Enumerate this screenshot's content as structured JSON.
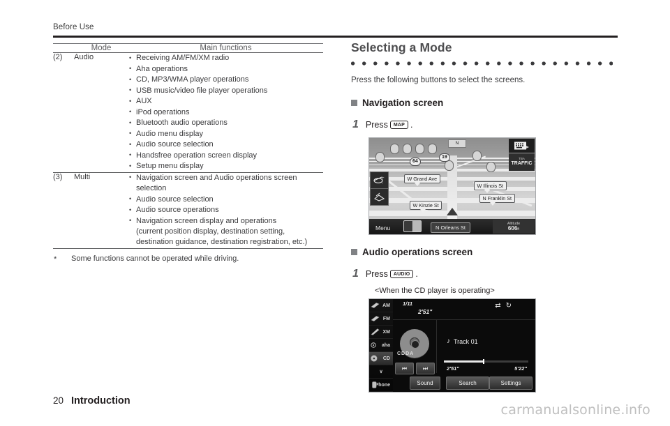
{
  "running_head": "Before Use",
  "page_footer": {
    "number": "20",
    "section": "Introduction"
  },
  "watermark": "carmanualsonline.info",
  "table": {
    "headers": {
      "num": "",
      "mode": "Mode",
      "functions": "Main functions"
    },
    "rows": [
      {
        "num": "(2)",
        "mode": "Audio",
        "functions": [
          "Receiving AM/FM/XM radio",
          "Aha operations",
          "CD, MP3/WMA player operations",
          "USB music/video file player operations",
          "AUX",
          "iPod operations",
          "Bluetooth audio operations",
          "Audio menu display",
          "Audio source selection",
          "Handsfree operation screen display",
          "Setup menu display"
        ]
      },
      {
        "num": "(3)",
        "mode": "Multi",
        "functions": [
          "Navigation screen and Audio operations screen",
          "Audio source selection",
          "Audio source operations",
          "Navigation screen display and operations"
        ],
        "continuations": {
          "0": "selection",
          "3": "(current position display, destination setting, destination guidance, destination registration, etc.)"
        }
      }
    ],
    "footnote": {
      "marker": "*",
      "text": "Some functions cannot be operated while driving."
    }
  },
  "right": {
    "section_title": "Selecting a Mode",
    "lead": "Press the following buttons to select the screens.",
    "nav_block": {
      "heading": "Navigation screen",
      "step_number": "1",
      "step_text_before": "Press",
      "key_label": "MAP",
      "step_text_after": "."
    },
    "audio_block": {
      "heading": "Audio operations screen",
      "step_number": "1",
      "step_text_before": "Press",
      "key_label": "AUDIO",
      "step_text_after": ".",
      "caption": "<When the CD player is operating>"
    }
  },
  "nav_screen": {
    "compass": "N",
    "shields": [
      {
        "label": "64"
      },
      {
        "label": "19"
      }
    ],
    "street_bubbles": [
      "W Grand Ave",
      "W Illinois St",
      "N Franklin St",
      "W Kinzie St"
    ],
    "keyboard_icon": "keyboard-icon",
    "traffic_button": {
      "small": "TBA",
      "label": "TRAFFIC"
    },
    "zoom_control": "zoom-in-out-icon",
    "view_control": "map-view-icon",
    "menu_label": "Menu",
    "split_screen_icon": "split-screen-icon",
    "current_street": "N Orleans St",
    "altitude": {
      "label": "Altitude",
      "value": "606",
      "unit": "ft"
    }
  },
  "audio_screen": {
    "sources": [
      {
        "label": "AM",
        "selected": false
      },
      {
        "label": "FM",
        "selected": false
      },
      {
        "label": "XM",
        "selected": false
      },
      {
        "label": "aha",
        "selected": false
      },
      {
        "label": "CD",
        "selected": true
      },
      {
        "label": "∨",
        "selected": false
      },
      {
        "label": "Phone",
        "selected": false
      }
    ],
    "track_number": "1/11",
    "track_time": "2'51\"",
    "shuffle_icon": "shuffle-icon",
    "repeat_icon": "repeat-icon",
    "disc_label": "CDDA",
    "prev_button": "⏮",
    "next_button": "⏭",
    "track_title": "Track 01",
    "elapsed": "2'51\"",
    "total": "5'22\"",
    "buttons": {
      "sound": "Sound",
      "search": "Search",
      "settings": "Settings"
    }
  },
  "colors": {
    "ink": "#231f20",
    "rule": "#6d6e71",
    "title_gray": "#4d4d4f",
    "watermark": "#bfbfbf"
  }
}
